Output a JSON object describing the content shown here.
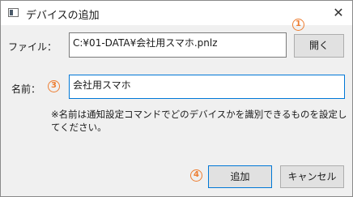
{
  "window": {
    "title": "デバイスの追加",
    "close_glyph": "✕"
  },
  "file_row": {
    "label": "ファイル：",
    "value": "C:¥01-DATA¥会社用スマホ.pnlz",
    "open_button": "開く"
  },
  "name_row": {
    "label": "名前：",
    "value": "会社用スマホ"
  },
  "note": "※名前は通知設定コマンドでどのデバイスかを識別できるものを設定してください。",
  "buttons": {
    "add": "追加",
    "cancel": "キャンセル"
  },
  "callouts": {
    "open": "1",
    "name": "3",
    "add": "4"
  },
  "colors": {
    "callout": "#ed7d31",
    "focus_border": "#0078d7"
  },
  "icons": {
    "app": "window-icon",
    "close": "close-icon"
  }
}
